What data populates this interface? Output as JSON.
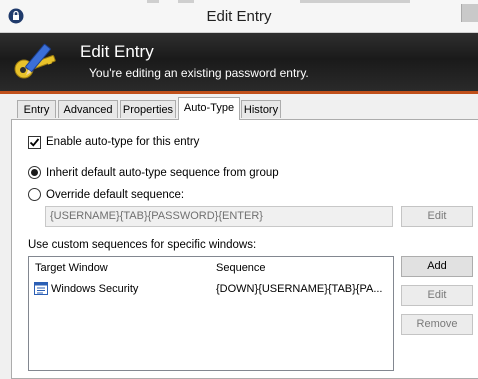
{
  "window": {
    "title": "Edit Entry"
  },
  "banner": {
    "title": "Edit Entry",
    "subtitle": "You're editing an existing password entry."
  },
  "tabs": [
    {
      "label": "Entry",
      "active": false
    },
    {
      "label": "Advanced",
      "active": false
    },
    {
      "label": "Properties",
      "active": false
    },
    {
      "label": "Auto-Type",
      "active": true
    },
    {
      "label": "History",
      "active": false
    }
  ],
  "autotype": {
    "enable_label": "Enable auto-type for this entry",
    "enable_checked": true,
    "inherit_label": "Inherit default auto-type sequence from group",
    "inherit_selected": true,
    "override_label": "Override default sequence:",
    "override_selected": false,
    "default_sequence": "{USERNAME}{TAB}{PASSWORD}{ENTER}",
    "edit_default_label": "Edit",
    "custom_label": "Use custom sequences for specific windows:"
  },
  "associations": {
    "columns": [
      "Target Window",
      "Sequence"
    ],
    "rows": [
      {
        "window": "Windows Security",
        "sequence": "{DOWN}{USERNAME}{TAB}{PA..."
      }
    ]
  },
  "buttons": {
    "add": "Add",
    "edit": "Edit",
    "remove": "Remove"
  }
}
